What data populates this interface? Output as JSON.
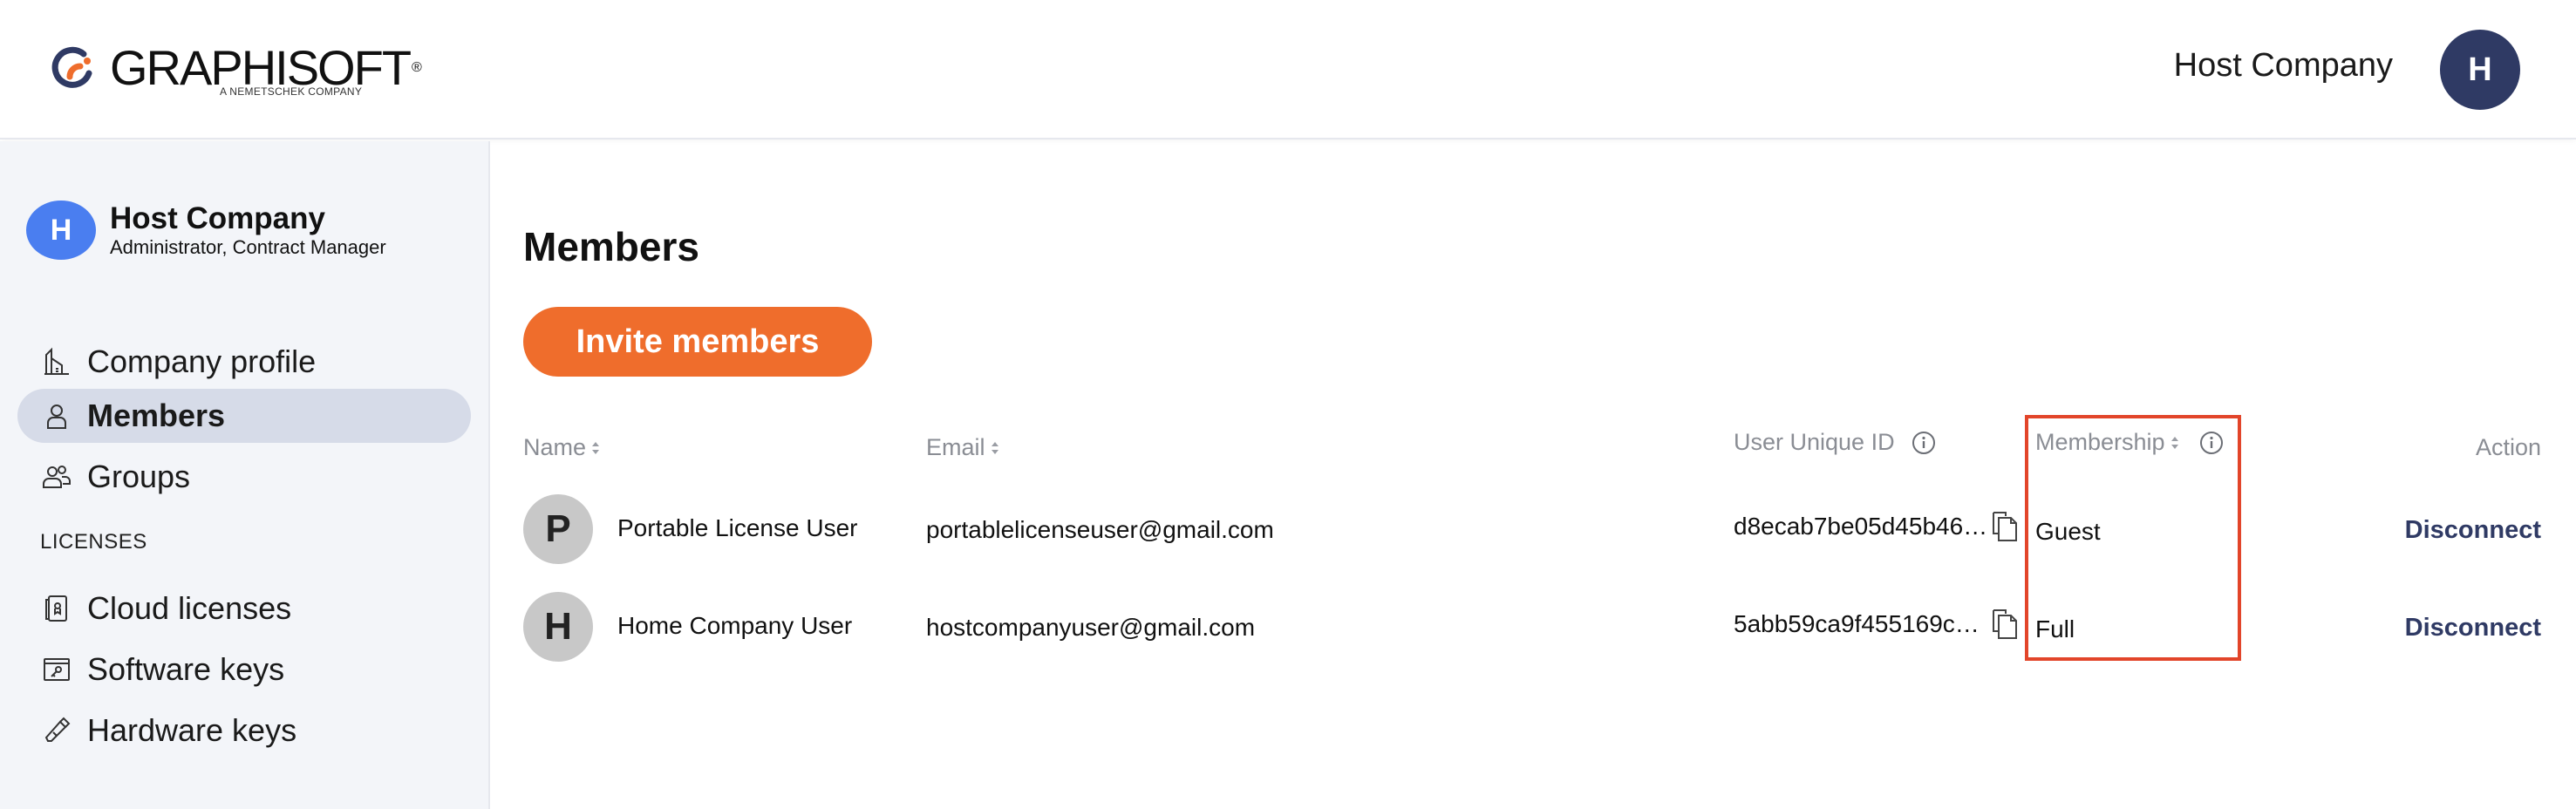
{
  "header": {
    "logo_text": "GRAPHISOFT",
    "logo_reg": "®",
    "logo_sub": "A NEMETSCHEK COMPANY",
    "company": "Host Company",
    "avatar_initial": "H"
  },
  "sidebar": {
    "company_name": "Host Company",
    "company_role": "Administrator, Contract Manager",
    "avatar_initial": "H",
    "items": [
      {
        "label": "Company profile",
        "icon": "building-icon",
        "active": false
      },
      {
        "label": "Members",
        "icon": "person-icon",
        "active": true
      },
      {
        "label": "Groups",
        "icon": "people-icon",
        "active": false
      }
    ],
    "licenses_label": "LICENSES",
    "license_items": [
      {
        "label": "Cloud licenses",
        "icon": "cloud-license-icon"
      },
      {
        "label": "Software keys",
        "icon": "software-key-icon"
      },
      {
        "label": "Hardware keys",
        "icon": "hardware-key-icon"
      }
    ]
  },
  "main": {
    "title": "Members",
    "invite_label": "Invite members",
    "columns": {
      "name": "Name",
      "email": "Email",
      "uid": "User Unique ID",
      "membership": "Membership",
      "action": "Action"
    },
    "rows": [
      {
        "initial": "P",
        "name": "Portable License User",
        "email": "portablelicenseuser@gmail.com",
        "uid": "d8ecab7be05d45b46…",
        "membership": "Guest",
        "action": "Disconnect"
      },
      {
        "initial": "H",
        "name": "Home Company User",
        "email": "hostcompanyuser@gmail.com",
        "uid": "5abb59ca9f455169c…",
        "membership": "Full",
        "action": "Disconnect"
      }
    ]
  },
  "colors": {
    "accent_orange": "#ef6d2c",
    "navy": "#2f3a64",
    "highlight_red": "#e2452a",
    "sidebar_bg": "#f3f5f9"
  }
}
